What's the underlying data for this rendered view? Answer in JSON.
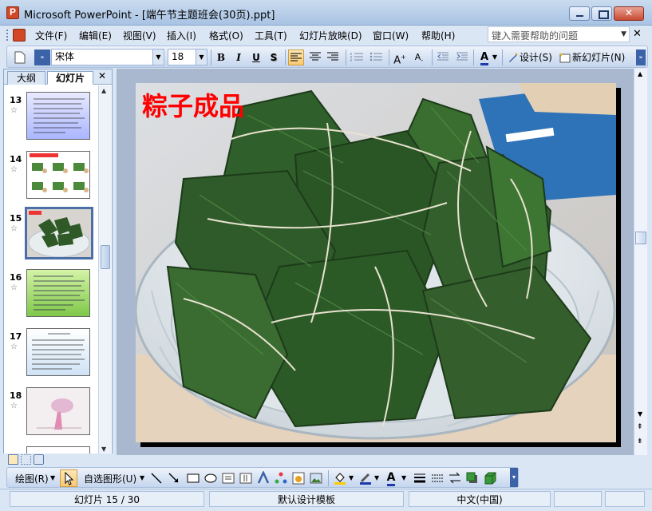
{
  "window": {
    "title": "Microsoft PowerPoint - [端午节主题班会(30页).ppt]"
  },
  "menu": {
    "items": [
      "文件(F)",
      "编辑(E)",
      "视图(V)",
      "插入(I)",
      "格式(O)",
      "工具(T)",
      "幻灯片放映(D)",
      "窗口(W)",
      "帮助(H)"
    ],
    "help_placeholder": "键入需要帮助的问题"
  },
  "toolbar": {
    "font_name": "宋体",
    "font_size": "18",
    "bold": "B",
    "italic": "I",
    "underline": "U",
    "shadow": "S",
    "design_label": "设计(S)",
    "new_slide_label": "新幻灯片(N)"
  },
  "pane": {
    "tab_outline": "大纲",
    "tab_slides": "幻灯片",
    "close": "✕",
    "slides": [
      {
        "num": "13",
        "kind": "text-blue"
      },
      {
        "num": "14",
        "kind": "steps"
      },
      {
        "num": "15",
        "kind": "photo",
        "selected": true
      },
      {
        "num": "16",
        "kind": "text-green"
      },
      {
        "num": "17",
        "kind": "text-light"
      },
      {
        "num": "18",
        "kind": "photo-pink"
      }
    ]
  },
  "slide": {
    "title": "粽子成品"
  },
  "drawbar": {
    "draw_label": "绘图(R)",
    "autoshape_label": "自选图形(U)"
  },
  "status": {
    "slide_info": "幻灯片 15 / 30",
    "template": "默认设计模板",
    "language": "中文(中国)"
  },
  "colors": {
    "title_red": "#ff0000",
    "accent_blue": "#4b6fa6"
  }
}
